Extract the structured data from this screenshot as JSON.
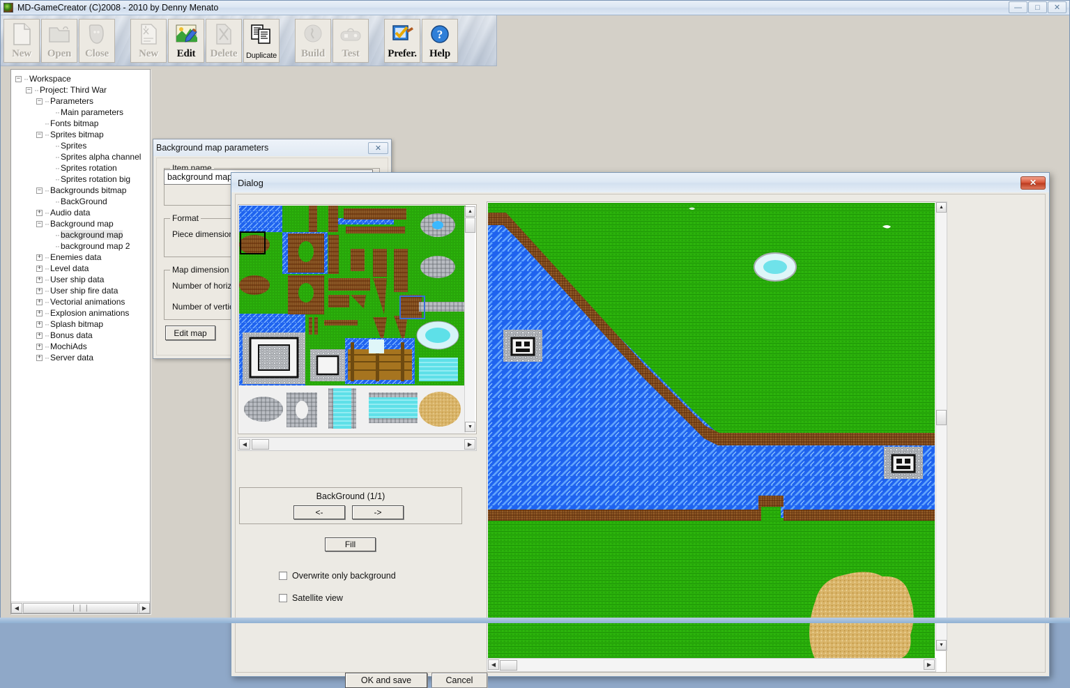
{
  "window": {
    "title": "MD-GameCreator (C)2008 - 2010 by Denny Menato",
    "app_icon": "app-logo-icon",
    "minimize": "—",
    "maximize": "□",
    "close": "✕"
  },
  "toolbar": {
    "buttons": [
      {
        "label": "New",
        "icon": "new-file-icon",
        "state": "disabled"
      },
      {
        "label": "Open",
        "icon": "open-folder-icon",
        "state": "disabled"
      },
      {
        "label": "Close",
        "icon": "close-lock-icon",
        "state": "disabled"
      },
      {
        "label": "New",
        "icon": "new-item-icon",
        "state": "disabled"
      },
      {
        "label": "Edit",
        "icon": "edit-icon",
        "state": "active"
      },
      {
        "label": "Delete",
        "icon": "delete-icon",
        "state": "disabled"
      },
      {
        "label": "Duplicate",
        "icon": "duplicate-icon",
        "state": "active"
      },
      {
        "label": "Build",
        "icon": "build-icon",
        "state": "disabled"
      },
      {
        "label": "Test",
        "icon": "gamepad-test-icon",
        "state": "disabled"
      },
      {
        "label": "Prefer.",
        "icon": "preferences-icon",
        "state": "active"
      },
      {
        "label": "Help",
        "icon": "help-icon",
        "state": "active"
      }
    ]
  },
  "tree": {
    "nodes": [
      {
        "label": "Workspace",
        "depth": 0,
        "expander": "minus",
        "selected": false
      },
      {
        "label": "Project: Third War",
        "depth": 1,
        "expander": "minus",
        "selected": false
      },
      {
        "label": "Parameters",
        "depth": 2,
        "expander": "minus",
        "selected": false
      },
      {
        "label": "Main parameters",
        "depth": 3,
        "expander": "leaf",
        "selected": false
      },
      {
        "label": "Fonts bitmap",
        "depth": 2,
        "expander": "leaf",
        "selected": false
      },
      {
        "label": "Sprites bitmap",
        "depth": 2,
        "expander": "minus",
        "selected": false
      },
      {
        "label": "Sprites",
        "depth": 3,
        "expander": "leaf",
        "selected": false
      },
      {
        "label": "Sprites alpha channel",
        "depth": 3,
        "expander": "leaf",
        "selected": false
      },
      {
        "label": "Sprites rotation",
        "depth": 3,
        "expander": "leaf",
        "selected": false
      },
      {
        "label": "Sprites rotation big",
        "depth": 3,
        "expander": "leaf",
        "selected": false
      },
      {
        "label": "Backgrounds bitmap",
        "depth": 2,
        "expander": "minus",
        "selected": false
      },
      {
        "label": "BackGround",
        "depth": 3,
        "expander": "leaf",
        "selected": false
      },
      {
        "label": "Audio data",
        "depth": 2,
        "expander": "plus",
        "selected": false
      },
      {
        "label": "Background map",
        "depth": 2,
        "expander": "minus",
        "selected": false
      },
      {
        "label": "background map",
        "depth": 3,
        "expander": "leaf",
        "selected": true
      },
      {
        "label": "background map 2",
        "depth": 3,
        "expander": "leaf",
        "selected": false
      },
      {
        "label": "Enemies data",
        "depth": 2,
        "expander": "plus",
        "selected": false
      },
      {
        "label": "Level data",
        "depth": 2,
        "expander": "plus",
        "selected": false
      },
      {
        "label": "User ship data",
        "depth": 2,
        "expander": "plus",
        "selected": false
      },
      {
        "label": "User ship fire data",
        "depth": 2,
        "expander": "plus",
        "selected": false
      },
      {
        "label": "Vectorial animations",
        "depth": 2,
        "expander": "plus",
        "selected": false
      },
      {
        "label": "Explosion animations",
        "depth": 2,
        "expander": "plus",
        "selected": false
      },
      {
        "label": "Splash bitmap",
        "depth": 2,
        "expander": "plus",
        "selected": false
      },
      {
        "label": "Bonus data",
        "depth": 2,
        "expander": "plus",
        "selected": false
      },
      {
        "label": "MochiAds",
        "depth": 2,
        "expander": "plus",
        "selected": false
      },
      {
        "label": "Server data",
        "depth": 2,
        "expander": "plus",
        "selected": false
      }
    ],
    "hscroll_grip": "❘❘❘",
    "arrow_left": "◀",
    "arrow_right": "▶"
  },
  "bgmap_window": {
    "title": "Background map parameters",
    "close_glyph": "✕",
    "item_name_legend": "Item name",
    "item_name_value": "background map",
    "format_legend": "Format",
    "piece_dimension_label": "Piece dimension",
    "map_dimension_legend": "Map dimension",
    "num_horizontal_label": "Number of horizo",
    "num_vertical_label": "Number of vertica",
    "edit_map_label": "Edit map"
  },
  "dialog": {
    "title": "Dialog",
    "close_glyph": "✕",
    "background_label": "BackGround (1/1)",
    "prev_label": "<-",
    "next_label": "->",
    "fill_label": "Fill",
    "checkboxes": [
      {
        "label": "Overwrite only background",
        "checked": false
      },
      {
        "label": "Satellite view",
        "checked": false
      }
    ],
    "ok_label": "OK and save",
    "cancel_label": "Cancel",
    "scroll": {
      "up": "▲",
      "down": "▼",
      "left": "◀",
      "right": "▶"
    }
  },
  "colors": {
    "grass": "#2cb40c",
    "water": "#1f63ef",
    "water_light": "#63a8ff",
    "dirt": "#7a4216",
    "sand": "#d9b469",
    "stone": "#b9bcc0",
    "accent_close": "#cc4422",
    "titlebar": "#dce7f3"
  }
}
